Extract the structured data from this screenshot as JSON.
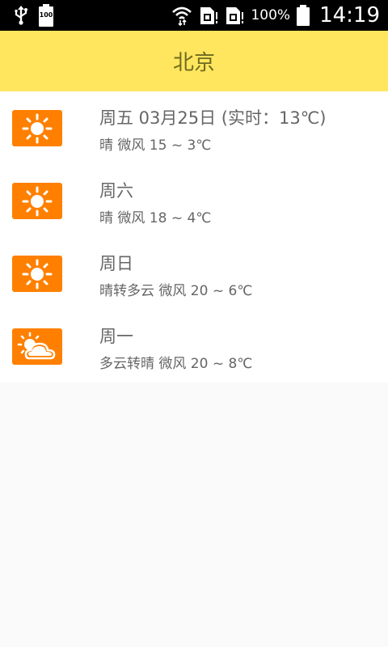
{
  "status_bar": {
    "battery_small_label": "100",
    "battery_percent": "100%",
    "time": "14:19",
    "icons": [
      "usb-icon",
      "battery-icon",
      "wifi-icon",
      "sim-icon",
      "sim-icon",
      "battery-icon"
    ]
  },
  "header": {
    "city": "北京",
    "background_color": "#ffe65e"
  },
  "forecast": [
    {
      "day": "周五 03月25日 (实时：13℃)",
      "desc": "晴 微风 15 ~ 3℃",
      "icon": "sunny-icon"
    },
    {
      "day": "周六",
      "desc": "晴 微风 18 ~ 4℃",
      "icon": "sunny-icon"
    },
    {
      "day": "周日",
      "desc": "晴转多云 微风 20 ~ 6℃",
      "icon": "sunny-icon"
    },
    {
      "day": "周一",
      "desc": "多云转晴 微风 20 ~ 8℃",
      "icon": "partly-cloudy-icon"
    }
  ],
  "colors": {
    "icon_background": "#ff8000",
    "text": "#666666"
  }
}
